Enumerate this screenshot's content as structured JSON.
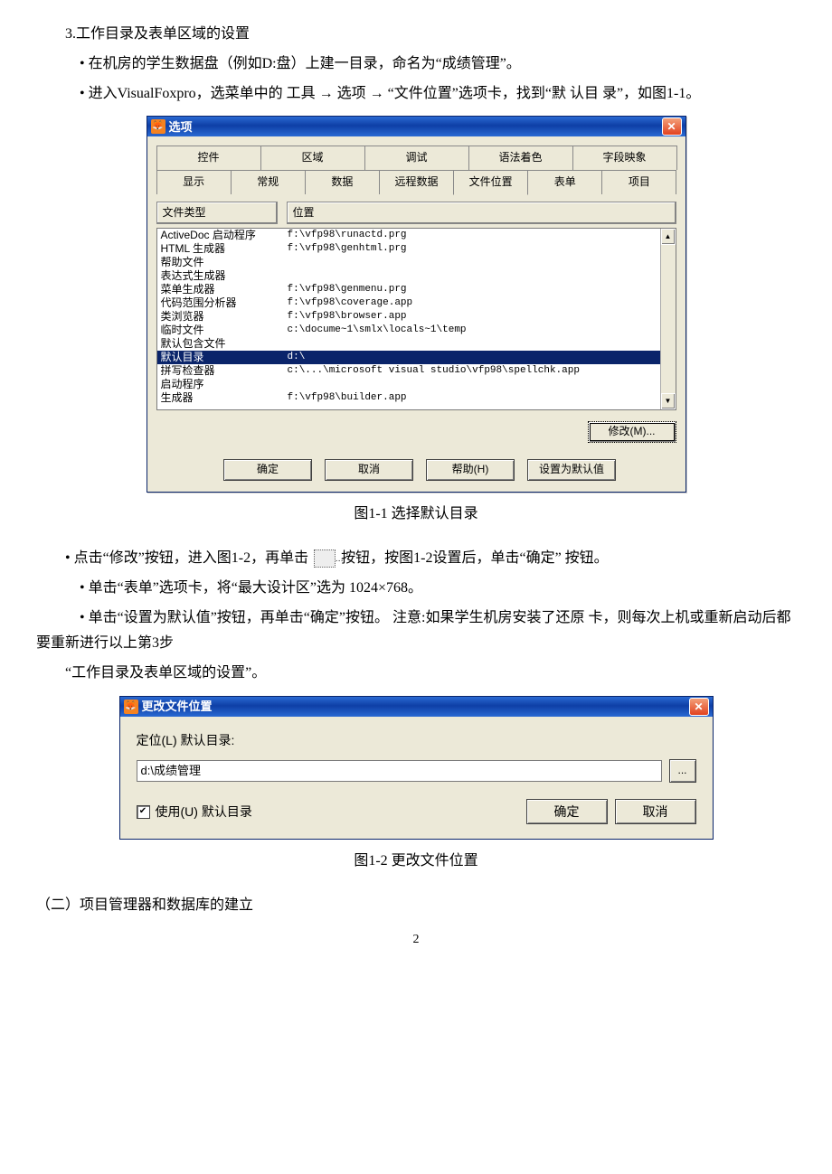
{
  "text": {
    "heading": "3.工作目录及表单区域的设置",
    "b1": "•  在机房的学生数据盘（例如D:盘）上建一目录，命名为“成绩管理”。",
    "b2": "• 进入VisualFoxpro，选菜单中的 工具 → 选项 → “文件位置”选项卡，找到“默 认目 录”，如图1-1。",
    "caption1": "图1-1    选择默认目录",
    "b3a": "• 点击“修改”按钮，进入图1-2，再单击",
    "b3b": "按钮，按图1-2设置后，单击“确定”  按钮。",
    "b4": "• 单击“表单”选项卡，将“最大设计区”选为 1024×768。",
    "b5": "•  单击“设置为默认值”按钮，再单击“确定”按钮。 注意:如果学生机房安装了还原 卡，则每次上机或重新启动后都要重新进行以上第3步",
    "b6": "“工作目录及表单区域的设置”。",
    "caption2": "图1-2    更改文件位置",
    "sect2": "（二）项目管理器和数据库的建立",
    "pagenum": "2"
  },
  "dialog1": {
    "title": "选项",
    "tabs_top": [
      "控件",
      "区域",
      "调试",
      "语法着色",
      "字段映象"
    ],
    "tabs_bottom": [
      "显示",
      "常规",
      "数据",
      "远程数据",
      "文件位置",
      "表单",
      "项目"
    ],
    "active_tab": "文件位置",
    "col1": "文件类型",
    "col2": "位置",
    "rows": [
      {
        "t": "ActiveDoc 启动程序",
        "p": "f:\\vfp98\\runactd.prg"
      },
      {
        "t": "HTML 生成器",
        "p": "f:\\vfp98\\genhtml.prg"
      },
      {
        "t": "帮助文件",
        "p": ""
      },
      {
        "t": "表达式生成器",
        "p": ""
      },
      {
        "t": "菜单生成器",
        "p": "f:\\vfp98\\genmenu.prg"
      },
      {
        "t": "代码范围分析器",
        "p": "f:\\vfp98\\coverage.app"
      },
      {
        "t": "类浏览器",
        "p": "f:\\vfp98\\browser.app"
      },
      {
        "t": "临时文件",
        "p": "c:\\docume~1\\smlx\\locals~1\\temp"
      },
      {
        "t": "默认包含文件",
        "p": ""
      },
      {
        "t": "默认目录",
        "p": "d:\\",
        "selected": true
      },
      {
        "t": "拼写检查器",
        "p": "c:\\...\\microsoft visual studio\\vfp98\\spellchk.app"
      },
      {
        "t": "启动程序",
        "p": ""
      },
      {
        "t": "生成器",
        "p": "f:\\vfp98\\builder.app"
      }
    ],
    "modify_btn": "修改(M)...",
    "ok": "确定",
    "cancel": "取消",
    "help": "帮助(H)",
    "default": "设置为默认值"
  },
  "dialog2": {
    "title": "更改文件位置",
    "label": "定位(L) 默认目录:",
    "value": "d:\\成绩管理",
    "browse": "...",
    "use_label": "使用(U) 默认目录",
    "use_checked": true,
    "ok": "确定",
    "cancel": "取消"
  }
}
